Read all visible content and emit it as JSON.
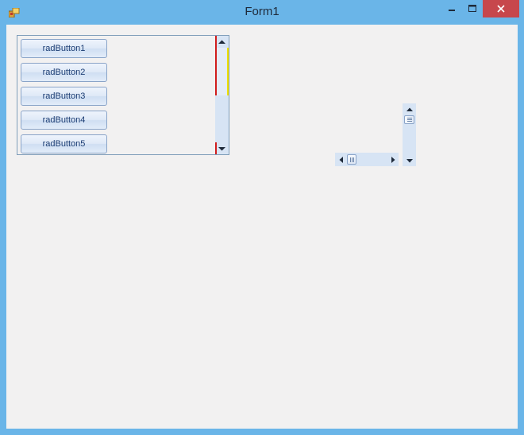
{
  "window": {
    "title": "Form1",
    "colors": {
      "frame": "#6ab5e8",
      "client": "#f2f1f1",
      "close": "#c7474c"
    }
  },
  "panel": {
    "buttons": [
      {
        "label": "radButton1"
      },
      {
        "label": "radButton2"
      },
      {
        "label": "radButton3"
      },
      {
        "label": "radButton4"
      },
      {
        "label": "radButton5"
      }
    ],
    "scrollbar_accent_colors": [
      "#d11c1c",
      "#f0e000"
    ]
  }
}
